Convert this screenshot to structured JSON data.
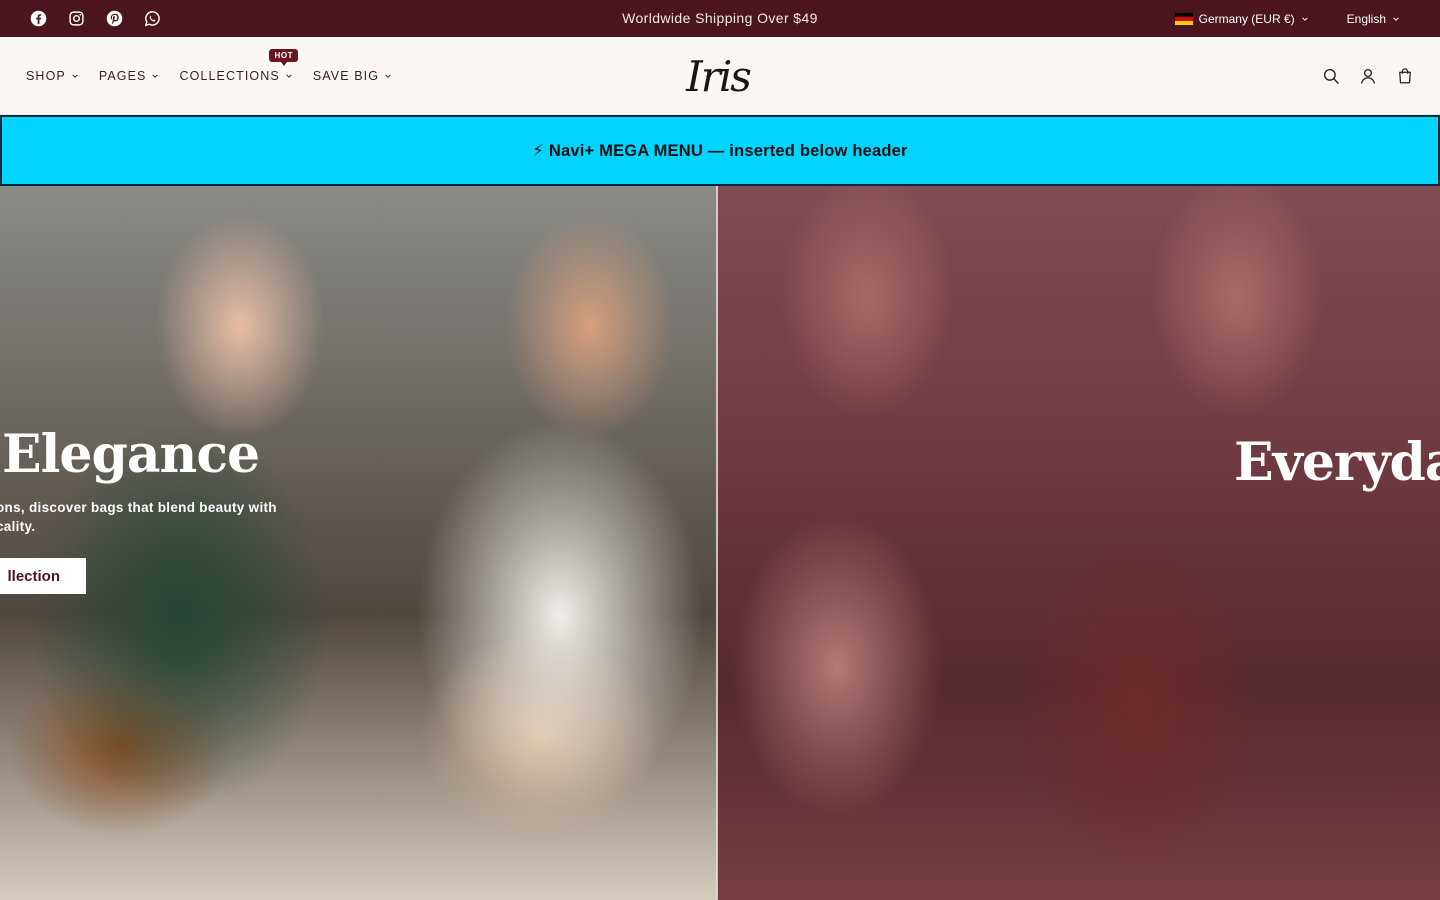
{
  "topbar": {
    "socials": [
      {
        "icon": "facebook-icon"
      },
      {
        "icon": "instagram-icon"
      },
      {
        "icon": "pinterest-icon"
      },
      {
        "icon": "whatsapp-icon"
      }
    ],
    "announcement": "Worldwide Shipping Over $49",
    "country_label": "Germany (EUR €)",
    "language_label": "English",
    "colors": {
      "background": "#4a151e"
    }
  },
  "header": {
    "nav": [
      {
        "label": "SHOP"
      },
      {
        "label": "PAGES"
      },
      {
        "label": "COLLECTIONS",
        "badge": "HOT"
      },
      {
        "label": "SAVE BIG"
      }
    ],
    "logo": "Iris",
    "icons": [
      "search-icon",
      "account-icon",
      "cart-icon"
    ]
  },
  "navi_banner": {
    "text": "⚡ Navi+ MEGA MENU — inserted below header",
    "color": "#00d4ff"
  },
  "hero": {
    "left": {
      "heading": "Elegance",
      "text": "ons, discover bags that blend beauty with cality.",
      "button": "llection"
    },
    "right": {
      "heading": "Everyday"
    }
  }
}
